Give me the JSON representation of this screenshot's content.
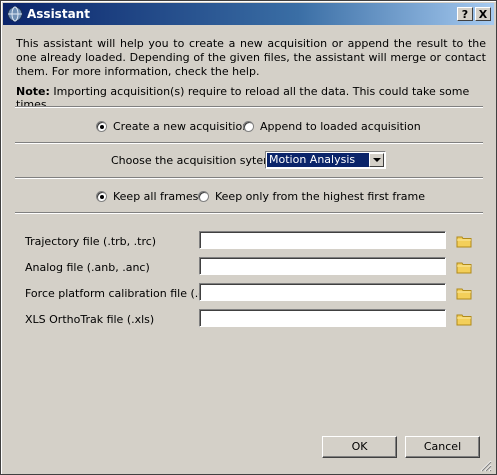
{
  "window": {
    "title": "Assistant",
    "help_label": "?",
    "close_label": "X"
  },
  "intro_text": "This assistant will help you to create a new acquisition or append the result to the one already loaded. Depending of the given files, the assistant will merge or contact them. For more information, check the help.",
  "note": {
    "label": "Note:",
    "text": " Importing acquisition(s) require to reload all the data. This could take some times."
  },
  "mode": {
    "create_label": "Create a new acquisition",
    "append_label": "Append to loaded acquisition",
    "selected": "create"
  },
  "system": {
    "label": "Choose the acquisition sytem:",
    "selected": "Motion Analysis"
  },
  "frames": {
    "keep_all_label": "Keep all frames",
    "keep_highest_label": "Keep only from the highest first frame",
    "selected": "keep_all"
  },
  "files": [
    {
      "label": "Trajectory file (.trb, .trc)",
      "value": ""
    },
    {
      "label": "Analog file (.anb, .anc)",
      "value": ""
    },
    {
      "label": "Force platform calibration file (.cal)",
      "value": ""
    },
    {
      "label": "XLS OrthoTrak file (.xls)",
      "value": ""
    }
  ],
  "buttons": {
    "ok": "OK",
    "cancel": "Cancel"
  },
  "icons": {
    "window": "globe-icon",
    "browse": "folder-icon"
  }
}
